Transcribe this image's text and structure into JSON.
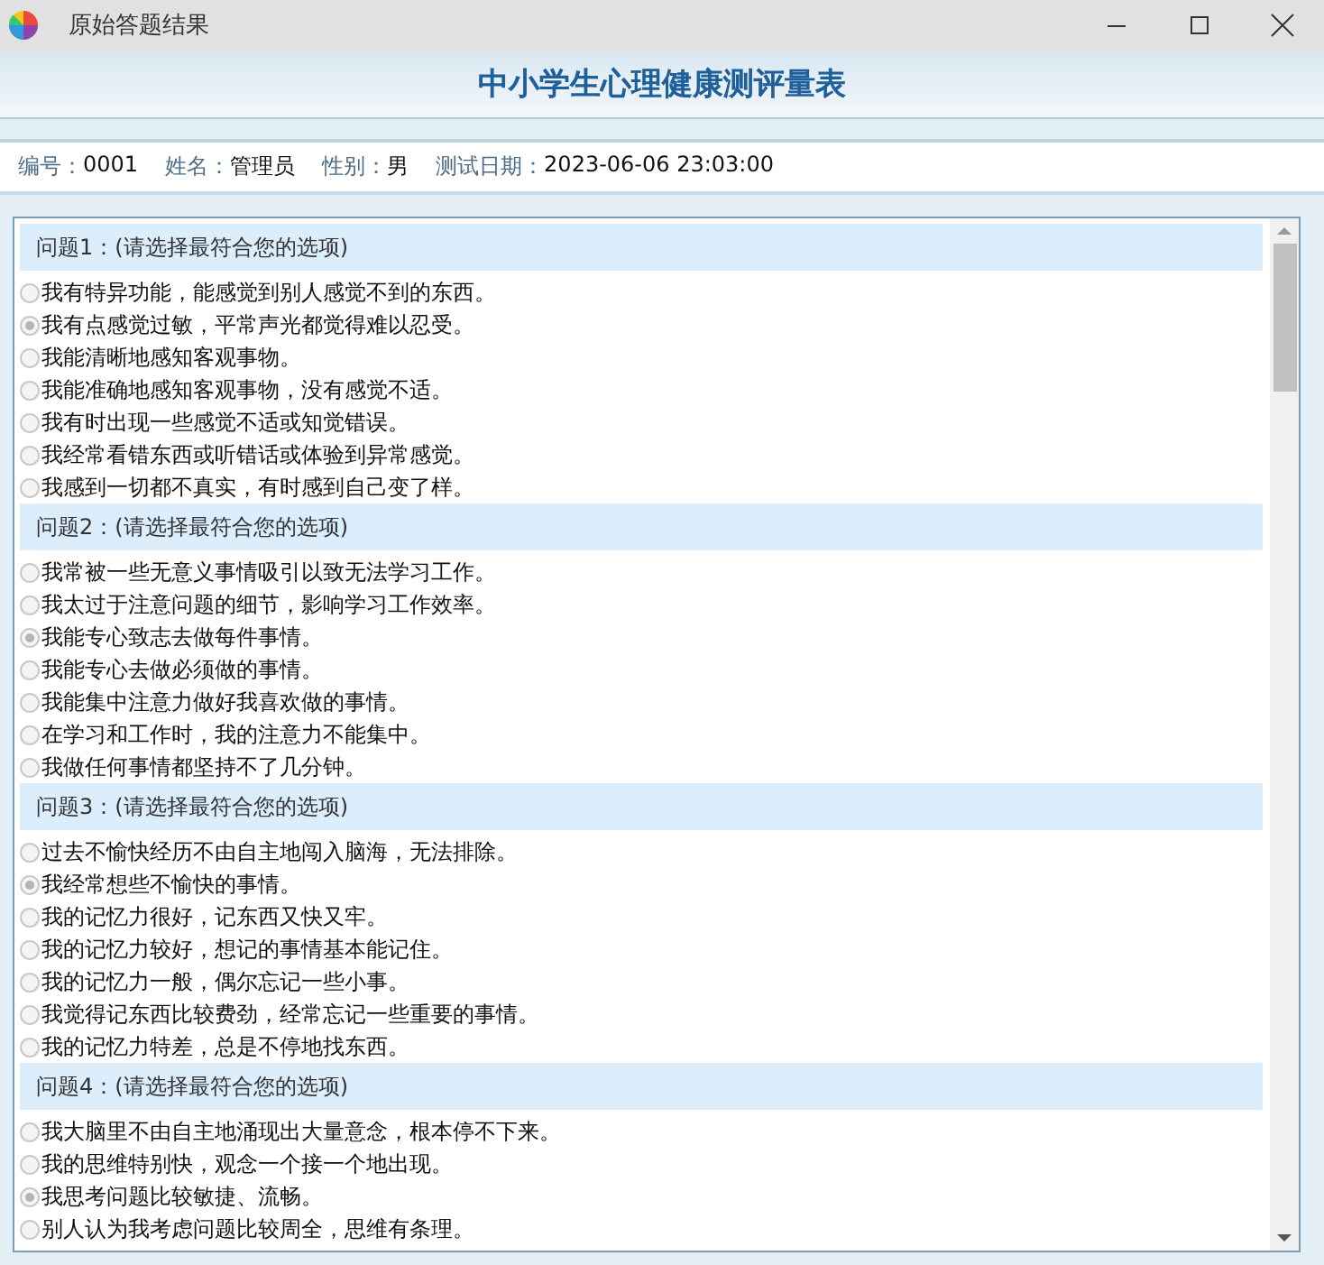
{
  "window": {
    "title": "原始答题结果"
  },
  "header": {
    "title": "中小学生心理健康测评量表"
  },
  "info": [
    {
      "label": "编号：",
      "value": "0001"
    },
    {
      "label": "姓名：",
      "value": "管理员"
    },
    {
      "label": "性别：",
      "value": "男"
    },
    {
      "label": "测试日期：",
      "value": "2023-06-06 23:03:00"
    }
  ],
  "questions": [
    {
      "title": "问题1：(请选择最符合您的选项)",
      "options": [
        {
          "text": "我有特异功能，能感觉到别人感觉不到的东西。",
          "selected": false
        },
        {
          "text": "我有点感觉过敏，平常声光都觉得难以忍受。",
          "selected": true
        },
        {
          "text": "我能清晰地感知客观事物。",
          "selected": false
        },
        {
          "text": "我能准确地感知客观事物，没有感觉不适。",
          "selected": false
        },
        {
          "text": "我有时出现一些感觉不适或知觉错误。",
          "selected": false
        },
        {
          "text": "我经常看错东西或听错话或体验到异常感觉。",
          "selected": false
        },
        {
          "text": "我感到一切都不真实，有时感到自己变了样。",
          "selected": false
        }
      ]
    },
    {
      "title": "问题2：(请选择最符合您的选项)",
      "options": [
        {
          "text": "我常被一些无意义事情吸引以致无法学习工作。",
          "selected": false
        },
        {
          "text": "我太过于注意问题的细节，影响学习工作效率。",
          "selected": false
        },
        {
          "text": "我能专心致志去做每件事情。",
          "selected": true
        },
        {
          "text": "我能专心去做必须做的事情。",
          "selected": false
        },
        {
          "text": "我能集中注意力做好我喜欢做的事情。",
          "selected": false
        },
        {
          "text": "在学习和工作时，我的注意力不能集中。",
          "selected": false
        },
        {
          "text": "我做任何事情都坚持不了几分钟。",
          "selected": false
        }
      ]
    },
    {
      "title": "问题3：(请选择最符合您的选项)",
      "options": [
        {
          "text": "过去不愉快经历不由自主地闯入脑海，无法排除。",
          "selected": false
        },
        {
          "text": "我经常想些不愉快的事情。",
          "selected": true
        },
        {
          "text": "我的记忆力很好，记东西又快又牢。",
          "selected": false
        },
        {
          "text": "我的记忆力较好，想记的事情基本能记住。",
          "selected": false
        },
        {
          "text": "我的记忆力一般，偶尔忘记一些小事。",
          "selected": false
        },
        {
          "text": "我觉得记东西比较费劲，经常忘记一些重要的事情。",
          "selected": false
        },
        {
          "text": "我的记忆力特差，总是不停地找东西。",
          "selected": false
        }
      ]
    },
    {
      "title": "问题4：(请选择最符合您的选项)",
      "options": [
        {
          "text": "我大脑里不由自主地涌现出大量意念，根本停不下来。",
          "selected": false
        },
        {
          "text": "我的思维特别快，观念一个接一个地出现。",
          "selected": false
        },
        {
          "text": "我思考问题比较敏捷、流畅。",
          "selected": true
        },
        {
          "text": "别人认为我考虑问题比较周全，思维有条理。",
          "selected": false
        }
      ]
    }
  ]
}
